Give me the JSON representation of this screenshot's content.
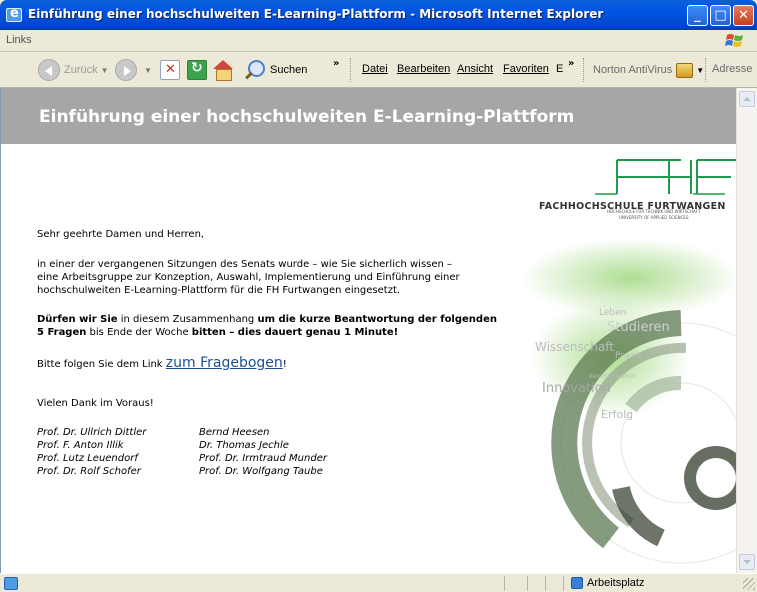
{
  "window": {
    "title": "Einführung einer hochschulweiten E-Learning-Plattform - Microsoft Internet Explorer"
  },
  "links_bar": {
    "label": "Links"
  },
  "toolbar": {
    "back": "Zurück",
    "search": "Suchen",
    "overflow": "»",
    "overflow2": "»"
  },
  "menu": {
    "file": "Datei",
    "edit": "Bearbeiten",
    "view": "Ansicht",
    "favorites": "Favoriten",
    "extra": "E",
    "antivirus": "Norton AntiVirus",
    "address": "Adresse"
  },
  "page": {
    "banner_title": "Einführung einer hochschulweiten E-Learning-Plattform",
    "logo": {
      "name": "FACHHOCHSCHULE FURTWANGEN",
      "sub1": "HOCHSCHULE FÜR TECHNIK UND WIRTSCHAFT",
      "sub2": "UNIVERSITY OF APPLIED SCIENCES"
    },
    "wheel_words": [
      "Leben",
      "Studieren",
      "Wissenschaft",
      "Praxis",
      "Kommunikation",
      "Innovation",
      "Erfolg"
    ],
    "greeting": "Sehr geehrte Damen und Herren,",
    "para1": [
      "in einer der vergangenen Sitzungen des Senats wurde – wie Sie sicherlich wissen –",
      "eine Arbeitsgruppe zur Konzeption, Auswahl, Implementierung und Einführung einer",
      "hochschulweiten E-Learning-Plattform für die FH Furtwangen eingesetzt."
    ],
    "para2": {
      "l1a": "Dürfen wir Sie",
      "l1b": " in diesem Zusammenhang ",
      "l1c": "um die kurze Beantwortung der folgenden",
      "l2a": "5 Fragen",
      "l2b": " bis Ende der Woche ",
      "l2c": "bitten – dies dauert genau 1 Minute!"
    },
    "link_intro": "Bitte folgen Sie dem Link ",
    "link_text": "zum Fragebogen",
    "link_suffix": "!",
    "thanks": "Vielen Dank im Voraus!",
    "signatures_left": [
      "Prof. Dr. Ullrich Dittler",
      "Prof. F. Anton Illik",
      "Prof. Lutz Leuendorf",
      "Prof. Dr. Rolf Schofer"
    ],
    "signatures_right": [
      "Bernd Heesen",
      "Dr. Thomas Jechle",
      "Prof. Dr. Irmtraud Munder",
      "Prof. Dr. Wolfgang Taube"
    ]
  },
  "status": {
    "zone": "Arbeitsplatz"
  },
  "colors": {
    "banner": "#a6a6a6",
    "logo_green": "#1f9b4a",
    "link": "#1f4f8f"
  }
}
